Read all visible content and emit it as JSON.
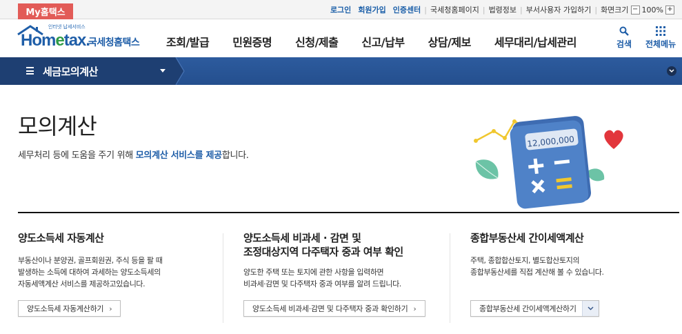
{
  "utilbar": {
    "my_tab": "My홈택스",
    "login": "로그인",
    "signup": "회원가입",
    "cert": "인증센터",
    "links": [
      "국세청홈페이지",
      "법령정보",
      "부서사용자 가입하기",
      "화면크기"
    ],
    "zoom_minus": "−",
    "zoom_value": "100%",
    "zoom_plus": "+"
  },
  "header": {
    "logo_tagline": "인터넷 납세서비스",
    "logo_word_a": "Hom",
    "logo_word_e": "e",
    "logo_word_b": "tax.",
    "logo_kr": "국세청홈택스",
    "gnb": [
      "조회/발급",
      "민원증명",
      "신청/제출",
      "신고/납부",
      "상담/제보",
      "세무대리/납세관리"
    ],
    "search_label": "검색",
    "allmenu_label": "전체메뉴"
  },
  "subbar": {
    "title": "세금모의계산"
  },
  "main": {
    "title": "모의계산",
    "desc_before": "세무처리 등에 도움을 주기 위해 ",
    "desc_highlight": "모의계산 서비스를 제공",
    "desc_after": "합니다.",
    "illus_amount": "12,000,000"
  },
  "columns": [
    {
      "title_lines": [
        "양도소득세 자동계산"
      ],
      "desc_lines": [
        "부동산이나 분양권, 골프회원권, 주식 등을 팔 때",
        "발생하는 소득에 대하여 과세하는 양도소득세의",
        "자동세액계산 서비스를 제공하고있습니다."
      ],
      "button": "양도소득세 자동계산하기"
    },
    {
      "title_lines": [
        "양도소득세 비과세 · 감면 및",
        "조정대상지역 다주택자 중과 여부 확인"
      ],
      "desc_lines": [
        "양도한 주택 또는 토지에 관한 사항을 입력하면",
        "비과세·감면 및 다주택자 중과 여부를 알려 드립니다."
      ],
      "button": "양도소득세 비과세·감면 및 다주택자 중과 확인하기"
    },
    {
      "title_lines": [
        "종합부동산세 간이세액계산"
      ],
      "desc_lines": [
        "주택, 종합합산토지, 별도합산토지의",
        "종합부동산세를 직접 계산해 볼 수 있습니다."
      ],
      "button": "종합부동산세 간이세액계산하기"
    }
  ],
  "colors": {
    "brand_blue": "#1f5ea8",
    "bar_blue": "#2d5b9e",
    "bar_dark": "#1e3f72",
    "my_tab_red": "#e25b57",
    "logo_green": "#2f9b45"
  }
}
